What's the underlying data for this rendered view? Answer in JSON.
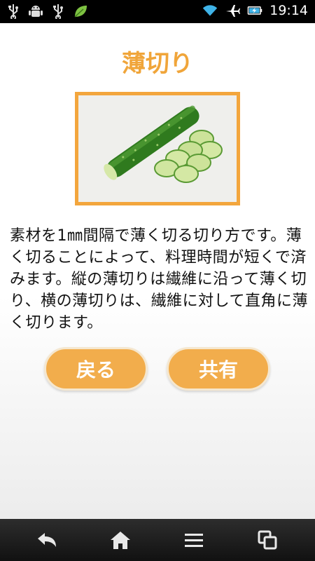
{
  "status_bar": {
    "time": "19:14",
    "icons": [
      "usb-icon",
      "android-debug-icon",
      "usb-icon",
      "leaf-icon",
      "wifi-icon",
      "airplane-icon",
      "battery-charging-icon"
    ]
  },
  "page": {
    "title": "薄切り",
    "description": "素材を1㎜間隔で薄く切る切り方です。薄く切ることによって、料理時間が短くで済みます。縦の薄切りは繊維に沿って薄く切り、横の薄切りは、繊維に対して直角に薄く切ります。",
    "image_alt_icon": "sliced-cucumber-photo"
  },
  "buttons": {
    "back_label": "戻る",
    "share_label": "共有"
  },
  "nav_bar": {
    "icons": [
      "back-icon",
      "home-icon",
      "menu-icon",
      "recent-apps-icon"
    ]
  },
  "colors": {
    "accent": "#f0a53a",
    "button": "#f2ad4c",
    "button_border": "#f5e7cf",
    "status_bar": "#000000"
  }
}
